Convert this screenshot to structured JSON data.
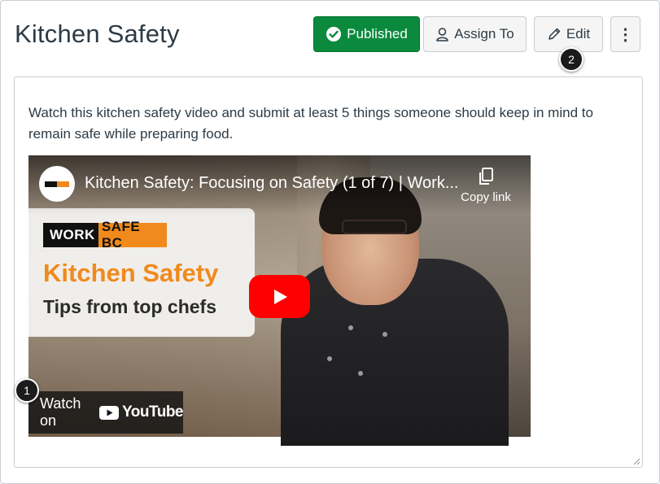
{
  "page": {
    "title": "Kitchen Safety"
  },
  "toolbar": {
    "published_label": "Published",
    "assign_label": "Assign To",
    "edit_label": "Edit",
    "more_label": "⋮"
  },
  "callouts": {
    "one": "1",
    "two": "2"
  },
  "content": {
    "description": "Watch this kitchen safety video and submit at least 5 things someone should keep in mind to remain safe while preparing food."
  },
  "video": {
    "title": "Kitchen Safety: Focusing on Safety (1 of 7) | Work...",
    "copy_link_label": "Copy link",
    "card_logo_work": "WORK",
    "card_logo_safe": "SAFE BC",
    "card_title": "Kitchen Safety",
    "card_subtitle": "Tips from top chefs",
    "watch_on_label": "Watch on",
    "youtube_word": "YouTube"
  },
  "colors": {
    "published_green": "#0b8a3e",
    "worksafe_orange": "#f08a1c",
    "youtube_red": "#ff0000",
    "text": "#2d3b45"
  }
}
